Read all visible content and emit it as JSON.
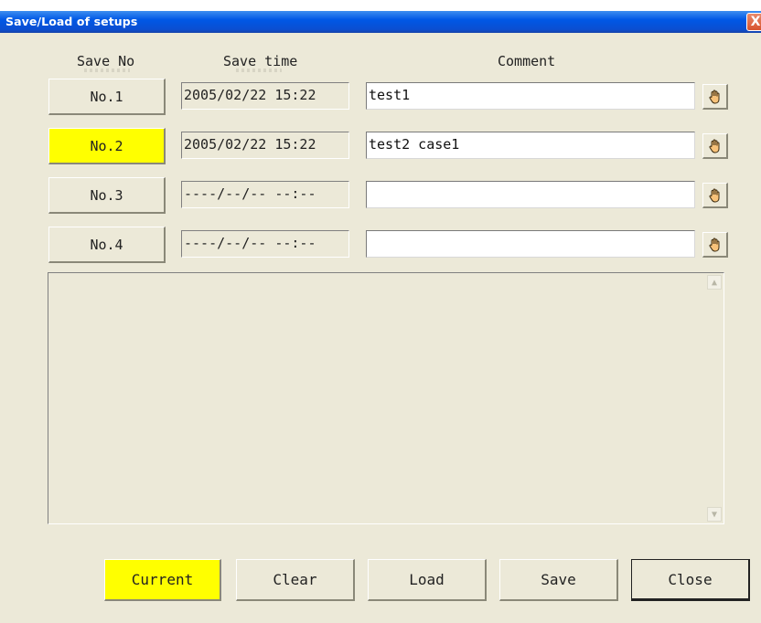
{
  "window": {
    "title": "Save/Load of setups",
    "close_glyph": "X"
  },
  "headers": {
    "save_no": "Save No",
    "save_time": "Save time",
    "comment": "Comment"
  },
  "slots": [
    {
      "label": "No.1",
      "time": "2005/02/22 15:22",
      "comment": "test1",
      "active": false
    },
    {
      "label": "No.2",
      "time": "2005/02/22 15:22",
      "comment": "test2 case1",
      "active": true
    },
    {
      "label": "No.3",
      "time": "----/--/-- --:--",
      "comment": "",
      "active": false
    },
    {
      "label": "No.4",
      "time": "----/--/-- --:--",
      "comment": "",
      "active": false
    }
  ],
  "icons": {
    "slot_action": "hand-pointer-icon",
    "scroll_up": "arrow-up-icon",
    "scroll_down": "arrow-down-icon"
  },
  "buttons": {
    "current": "Current",
    "clear": "Clear",
    "load": "Load",
    "save": "Save",
    "close": "Close"
  },
  "colors": {
    "highlight": "#ffff00",
    "face": "#ece9d8",
    "titlebar": "#0058e6"
  }
}
